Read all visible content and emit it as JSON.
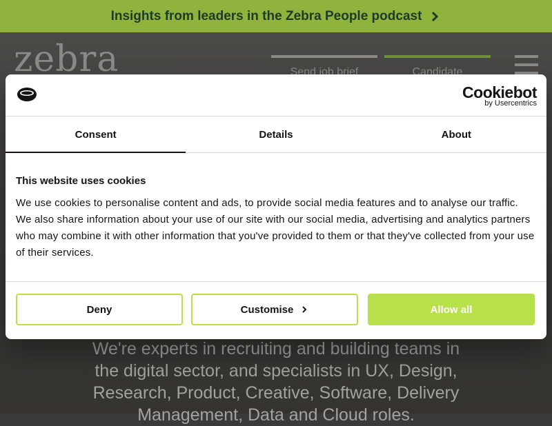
{
  "banner": {
    "text": "Insights from leaders in the Zebra People podcast",
    "icon": "chevron-right-icon"
  },
  "header": {
    "logo": "zebra",
    "nav": [
      {
        "label": "Send job brief",
        "icon": "chevron-down-icon"
      },
      {
        "label": "Candidate",
        "icon": "chevron-down-icon"
      }
    ],
    "menu_icon": "hamburger-icon"
  },
  "hero": {
    "text": "We're experts in recruiting and building teams in the digital sector, and specialists in UX, Design, Research, Product, Creative, Software, Delivery Management, Data and Cloud roles."
  },
  "cookie_dialog": {
    "brand": {
      "name": "Cookiebot",
      "sub": "by Usercentrics"
    },
    "tabs": [
      {
        "label": "Consent"
      },
      {
        "label": "Details"
      },
      {
        "label": "About"
      }
    ],
    "active_tab": "Consent",
    "title": "This website uses cookies",
    "body": "We use cookies to personalise content and ads, to provide social media features and to analyse our traffic. We also share information about your use of our site with our social media, advertising and analytics partners who may combine it with other information that you've provided to them or that they've collected from your use of their services.",
    "buttons": {
      "deny": "Deny",
      "customise": "Customise",
      "allow": "Allow all"
    }
  },
  "colors": {
    "banner": "#8fb33c",
    "accent": "#b7e04a",
    "text_dark": "#141414"
  }
}
